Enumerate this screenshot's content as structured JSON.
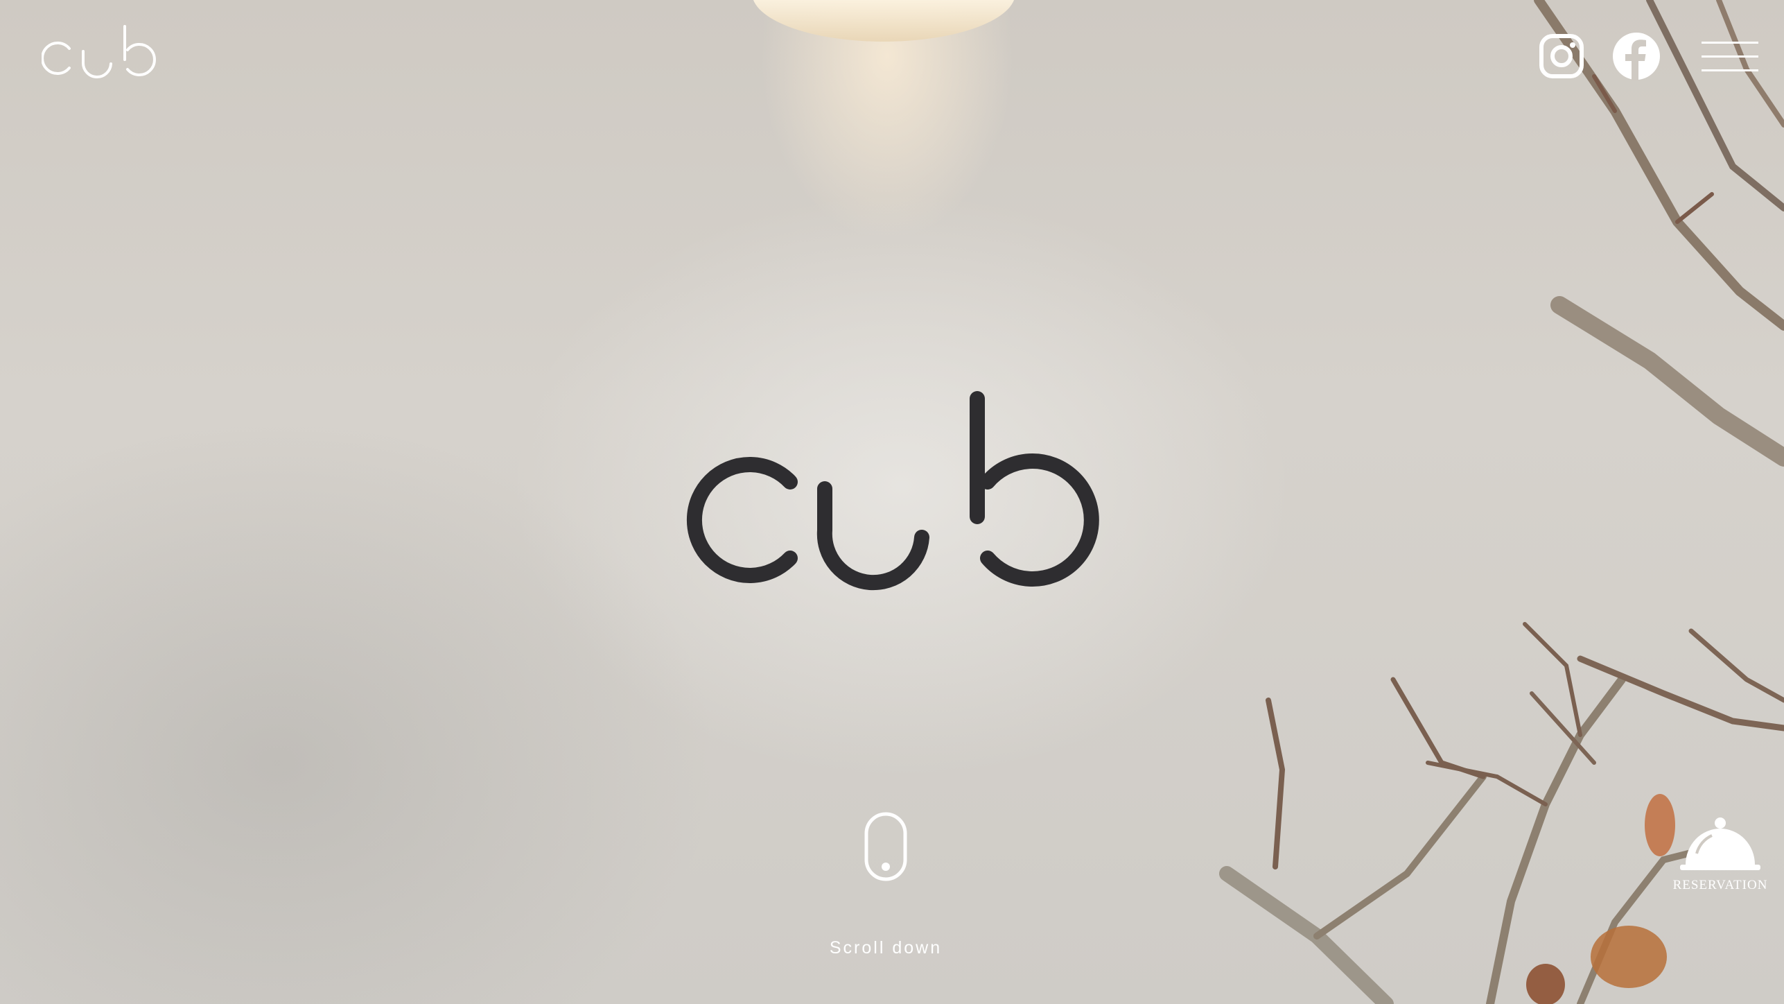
{
  "brand": {
    "name": "cub"
  },
  "header": {
    "icons": [
      "instagram-icon",
      "facebook-icon",
      "hamburger-menu-icon"
    ]
  },
  "scroll": {
    "label": "Scroll down",
    "icon": "mouse-icon"
  },
  "reservation": {
    "label": "RESERVATION",
    "icon": "service-bell-icon"
  },
  "colors": {
    "overlay_text": "#ffffff",
    "sign": "#2e2d30"
  }
}
